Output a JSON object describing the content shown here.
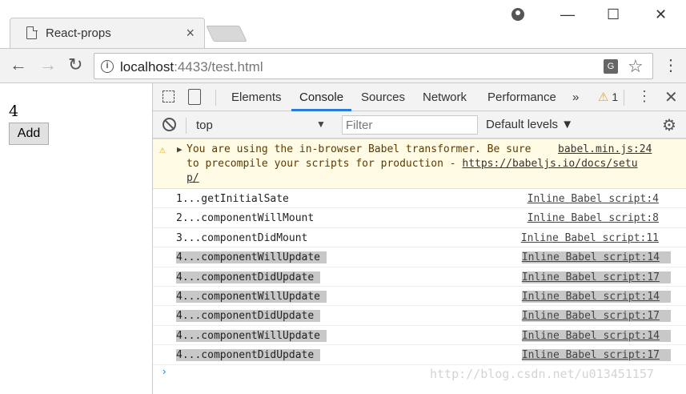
{
  "window": {
    "tab_title": "React-props",
    "tab_close": "×",
    "controls": {
      "minimize": "—",
      "maximize": "☐",
      "close": "✕"
    }
  },
  "toolbar": {
    "back": "←",
    "forward": "→",
    "reload": "↻",
    "url_host": "localhost",
    "url_rest": ":4433/test.html",
    "menu": "⋮"
  },
  "page": {
    "counter_value": "4",
    "add_button_label": "Add"
  },
  "devtools": {
    "tabs": [
      "Elements",
      "Console",
      "Sources",
      "Network",
      "Performance"
    ],
    "active_tab": "Console",
    "more_tabs": "»",
    "warning_count": "1",
    "menu": "⋮",
    "close": "✕",
    "context": "top",
    "filter_placeholder": "Filter",
    "levels": "Default levels ▼",
    "prompt": "›"
  },
  "console": {
    "warning": {
      "line1": "You are using the in-browser Babel transformer. Be sure",
      "line2_text": "to precompile your scripts for production - ",
      "line2_link": "https://babeljs.io/docs/setu",
      "line3_link": "p/",
      "source": "babel.min.js:24"
    },
    "logs": [
      {
        "msg": "1...getInitialSate",
        "src": "Inline Babel script:4",
        "highlight": false
      },
      {
        "msg": "2...componentWillMount",
        "src": "Inline Babel script:8",
        "highlight": false
      },
      {
        "msg": "3...componentDidMount",
        "src": "Inline Babel script:11",
        "highlight": false
      },
      {
        "msg": "4...componentWillUpdate",
        "src": "Inline Babel script:14",
        "highlight": true
      },
      {
        "msg": "4...componentDidUpdate",
        "src": "Inline Babel script:17",
        "highlight": true
      },
      {
        "msg": "4...componentWillUpdate",
        "src": "Inline Babel script:14",
        "highlight": true
      },
      {
        "msg": "4...componentDidUpdate",
        "src": "Inline Babel script:17",
        "highlight": true
      },
      {
        "msg": "4...componentWillUpdate",
        "src": "Inline Babel script:14",
        "highlight": true
      },
      {
        "msg": "4...componentDidUpdate",
        "src": "Inline Babel script:17",
        "highlight": true
      }
    ]
  },
  "watermark": "http://blog.csdn.net/u013451157"
}
